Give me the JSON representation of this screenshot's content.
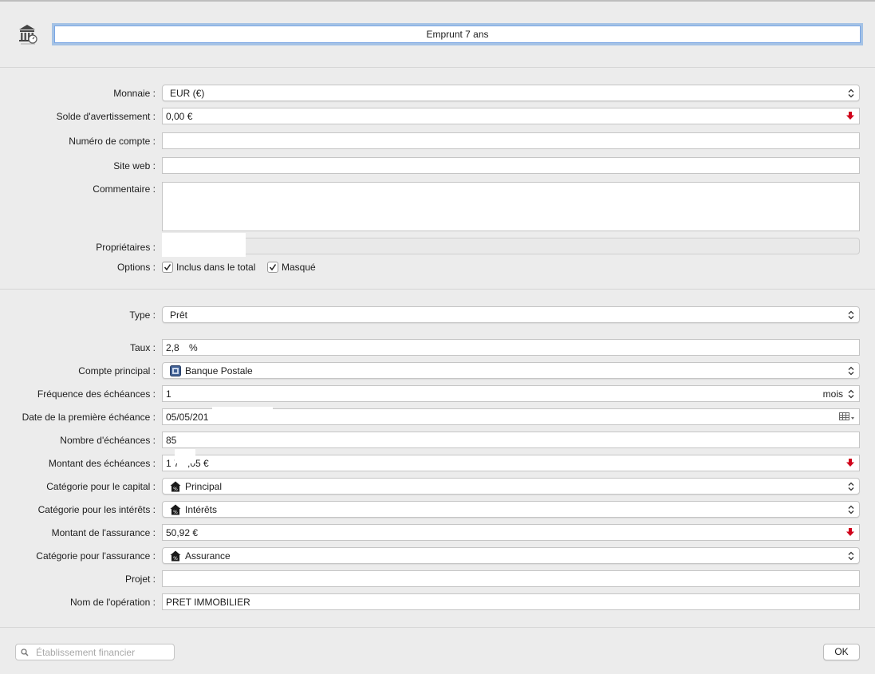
{
  "account": {
    "title": "Emprunt 7 ans",
    "icon": "bank-icon"
  },
  "general": {
    "currency_label": "Monnaie :",
    "currency_value": "EUR (€)",
    "warning_balance_label": "Solde d'avertissement :",
    "warning_balance_value": "0,00 €",
    "account_number_label": "Numéro de compte :",
    "account_number_value": "",
    "website_label": "Site web :",
    "website_value": "",
    "comment_label": "Commentaire :",
    "comment_value": "",
    "owners_label": "Propriétaires :",
    "options_label": "Options :",
    "option_include_total": "Inclus dans le total",
    "option_hidden": "Masqué"
  },
  "loan": {
    "type_label": "Type :",
    "type_value": "Prêt",
    "rate_label": "Taux :",
    "rate_value": "2,8",
    "rate_unit": "%",
    "main_account_label": "Compte principal :",
    "main_account_value": "Banque Postale",
    "frequency_label": "Fréquence des échéances :",
    "frequency_value": "1",
    "frequency_unit": "mois",
    "first_due_label": "Date de la première échéance :",
    "first_due_value": "05/05/201",
    "count_label": "Nombre d'échéances :",
    "count_value": "85",
    "amount_label": "Montant des échéances :",
    "amount_value_start": "1 7",
    "amount_value_end": ",05 €",
    "capital_category_label": "Catégorie pour le capital :",
    "capital_category_value": "Principal",
    "interest_category_label": "Catégorie pour les intérêts :",
    "interest_category_value": "Intérêts",
    "insurance_amount_label": "Montant de l'assurance :",
    "insurance_amount_value": "50,92 €",
    "insurance_category_label": "Catégorie pour l'assurance :",
    "insurance_category_value": "Assurance",
    "project_label": "Projet :",
    "project_value": "",
    "operation_name_label": "Nom de l'opération :",
    "operation_name_value": "PRET IMMOBILIER"
  },
  "footer": {
    "search_placeholder": "Établissement financier",
    "ok_label": "OK"
  },
  "colors": {
    "accent_focus": "#6aa0e0",
    "warning_arrow": "#d0021b"
  }
}
